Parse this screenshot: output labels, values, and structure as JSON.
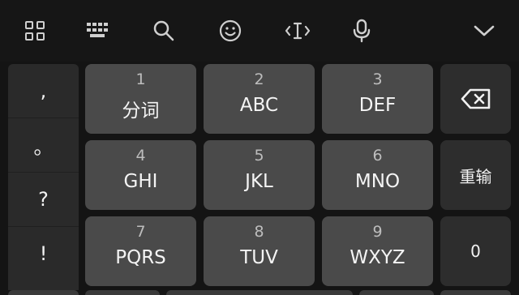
{
  "toolbar": {
    "icons": [
      "grid-icon",
      "keyboard-icon",
      "search-icon",
      "emoji-icon",
      "cursor-icon",
      "microphone-icon",
      "chevron-down-icon"
    ]
  },
  "punctuation": [
    ",",
    "。",
    "?",
    "!"
  ],
  "keys": [
    {
      "num": "1",
      "letters": "分词"
    },
    {
      "num": "2",
      "letters": "ABC"
    },
    {
      "num": "3",
      "letters": "DEF"
    },
    {
      "num": "4",
      "letters": "GHI"
    },
    {
      "num": "5",
      "letters": "JKL"
    },
    {
      "num": "6",
      "letters": "MNO"
    },
    {
      "num": "7",
      "letters": "PQRS"
    },
    {
      "num": "8",
      "letters": "TUV"
    },
    {
      "num": "9",
      "letters": "WXYZ"
    }
  ],
  "side": {
    "delete_icon": "backspace-icon",
    "reenter_label": "重输",
    "zero_label": "0"
  },
  "colors": {
    "background": "#141414",
    "key": "#4a4a4a",
    "side_key": "#2d2d2d",
    "text": "#f2f2f2"
  }
}
